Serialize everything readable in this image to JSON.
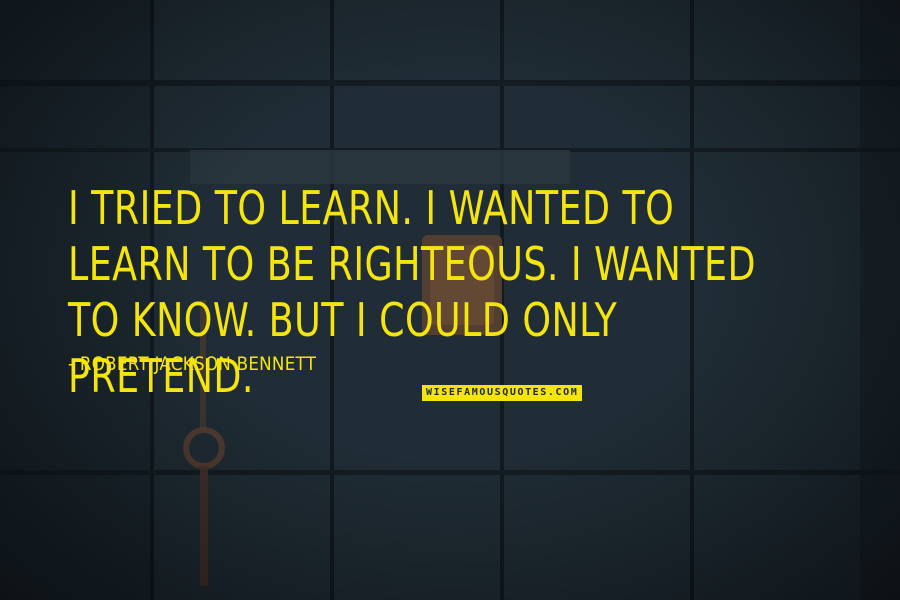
{
  "quote": {
    "text": "I tried to learn. I wanted to learn to be righteous. I wanted to know. But I could only pretend.",
    "author": "- Robert Jackson Bennett"
  },
  "watermark": {
    "text": "WISEFAMOUSQUOTES.COM"
  },
  "colors": {
    "text": "#f5e50e",
    "background": "#1d2a33"
  }
}
